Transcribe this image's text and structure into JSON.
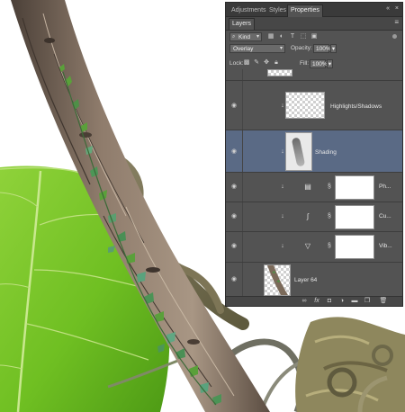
{
  "panel": {
    "tabs": [
      "Adjustments",
      "Styles",
      "Properties"
    ],
    "active_tab": "Properties",
    "collapse_glyph": "«",
    "close_glyph": "×",
    "sub_panel_title": "Layers",
    "panel_menu_glyph": "≡"
  },
  "filter": {
    "kind_label": "Kind",
    "icon_names": [
      "pixel-filter-icon",
      "adjustment-filter-icon",
      "type-filter-icon",
      "shape-filter-icon",
      "smart-object-filter-icon"
    ]
  },
  "blend": {
    "mode": "Overlay",
    "opacity_label": "Opacity:",
    "opacity_value": "100%"
  },
  "lock": {
    "label": "Lock:",
    "fill_label": "Fill:",
    "fill_value": "100%"
  },
  "layers": [
    {
      "name": "",
      "type": "pixel",
      "thumb": "checker-top",
      "selected": false
    },
    {
      "name": "Highlights/Shadows",
      "type": "pixel",
      "thumb": "checker",
      "selected": false
    },
    {
      "name": "Shading",
      "type": "pixel",
      "thumb": "shading",
      "selected": true
    },
    {
      "name": "Ph...",
      "type": "adjustment",
      "adj_icon": "photo-filter-icon",
      "selected": false
    },
    {
      "name": "Cu...",
      "type": "adjustment",
      "adj_icon": "curves-icon",
      "selected": false
    },
    {
      "name": "Vib...",
      "type": "adjustment",
      "adj_icon": "vibrance-icon",
      "selected": false
    },
    {
      "name": "Layer 64",
      "type": "pixel",
      "thumb": "branch",
      "selected": false
    }
  ],
  "footer_icons": [
    "link-layers-icon",
    "fx-icon",
    "add-mask-icon",
    "new-adjustment-icon",
    "new-group-icon",
    "new-layer-icon",
    "delete-layer-icon"
  ],
  "colors": {
    "panel_bg": "#535353",
    "selected_row": "#5a6a85",
    "leaf_green": "#7cc52a",
    "branch_brown": "#6e5a48"
  }
}
